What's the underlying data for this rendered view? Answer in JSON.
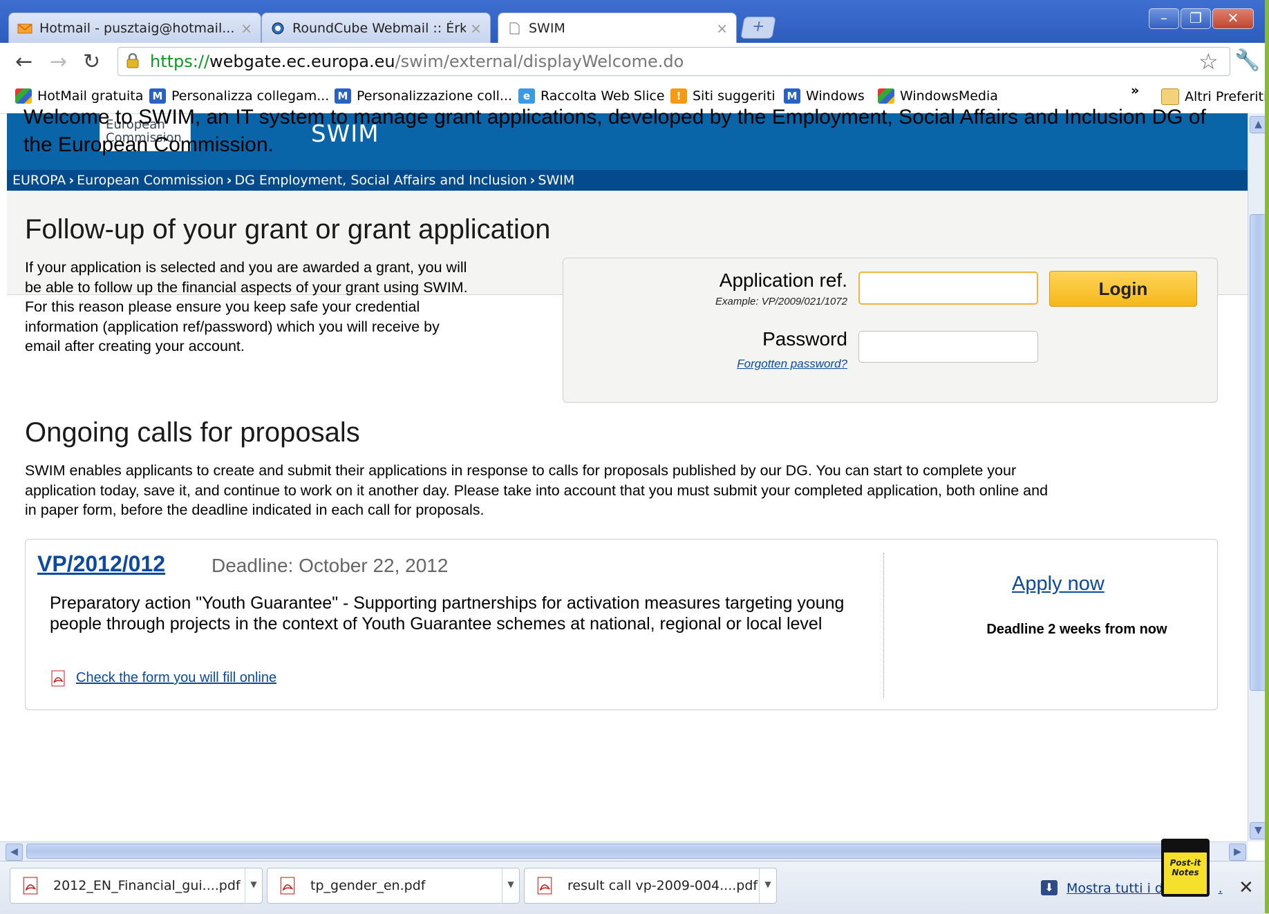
{
  "browser": {
    "tabs": [
      {
        "title": "Hotmail - pusztaig@hotmail...",
        "icon": "hotmail-envelope-icon"
      },
      {
        "title": "RoundCube Webmail :: Érk...",
        "icon": "roundcube-globe-icon"
      },
      {
        "title": "SWIM",
        "icon": "page-icon"
      }
    ],
    "url": {
      "scheme": "https://",
      "host": "webgate.ec.europa.eu",
      "path": "/swim/external/displayWelcome.do"
    },
    "bookmarks": [
      {
        "label": "HotMail gratuita",
        "icon": "windows-flag-icon"
      },
      {
        "label": "Personalizza collegam...",
        "icon": "msn-m-icon"
      },
      {
        "label": "Personalizzazione coll...",
        "icon": "msn-m-icon"
      },
      {
        "label": "Raccolta Web Slice",
        "icon": "ie-e-icon"
      },
      {
        "label": "Siti suggeriti",
        "icon": "lightbulb-icon"
      },
      {
        "label": "Windows",
        "icon": "msn-m-icon"
      },
      {
        "label": "WindowsMedia",
        "icon": "windows-flag-icon"
      }
    ],
    "bookmarks_overflow": "»",
    "other_bookmarks": "Altri Preferiti"
  },
  "page": {
    "logo_text": [
      "European",
      "Commission"
    ],
    "site_title": "SWIM",
    "breadcrumb": [
      "EUROPA",
      "European Commission",
      "DG Employment, Social Affairs and Inclusion",
      "SWIM"
    ],
    "welcome": "Welcome to SWIM, an IT system to manage grant applications, developed by the Employment, Social Affairs and Inclusion DG of the European Commission.",
    "followup": {
      "heading": "Follow-up of your grant or grant application",
      "text": "If your application is selected and you are awarded a grant, you will be able to follow up the financial aspects of your grant using SWIM. For this reason please ensure you keep safe your credential information (application ref/password) which you will receive by email after creating your account."
    },
    "login": {
      "appref_label": "Application ref.",
      "appref_example": "Example: VP/2009/021/1072",
      "appref_value": "",
      "password_label": "Password",
      "forgot_link": "Forgotten password?",
      "password_value": "",
      "button": "Login"
    },
    "calls": {
      "heading": "Ongoing calls for proposals",
      "text": "SWIM enables applicants to create and submit their applications in response to calls for proposals published by our DG. You can start to complete your application today, save it, and continue to work on it another day. Please take into account that you must submit your completed application, both online and in paper form, before the deadline indicated in each call for proposals.",
      "items": [
        {
          "ref": "VP/2012/012",
          "deadline": "Deadline: October 22, 2012",
          "description": "Preparatory action \"Youth Guarantee\" - Supporting partnerships for activation measures targeting young people through projects in the context of Youth Guarantee schemes at national, regional or local level",
          "form_link": "Check the form you will fill online",
          "apply_label": "Apply now",
          "deadline_note": "Deadline 2 weeks from now"
        }
      ]
    }
  },
  "downloads": {
    "items": [
      {
        "name": "2012_EN_Financial_gui....pdf"
      },
      {
        "name": "tp_gender_en.pdf"
      },
      {
        "name": "result call vp-2009-004....pdf"
      }
    ],
    "show_all": "Mostra tutti i do",
    "show_all_suffix": "."
  },
  "postit": {
    "line1": "Post-it",
    "line2": "Notes"
  },
  "colors": {
    "ec_blue": "#0a65a8",
    "breadcrumb_blue": "#034b8c",
    "link_blue": "#0b4aa0",
    "login_button": "#f5b81b"
  }
}
